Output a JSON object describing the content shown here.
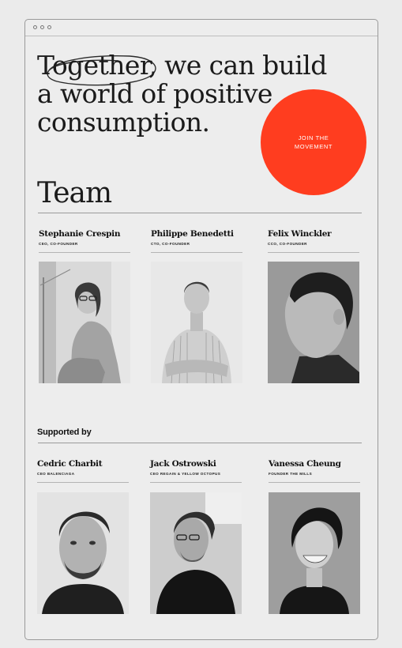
{
  "hero": {
    "line1_a": "Together,",
    "line1_b": " we can build",
    "line2": "a world of positive",
    "line3": "consumption."
  },
  "cta": {
    "line1": "JOIN THE",
    "line2": "MOVEMENT",
    "color": "#ff3d1f"
  },
  "team": {
    "title": "Team",
    "members": [
      {
        "name": "Stephanie Crespin",
        "role": "CEO, CO-FOUNDER",
        "photo": "portrait-woman-seated"
      },
      {
        "name": "Philippe Benedetti",
        "role": "CTO, CO-FOUNDER",
        "photo": "portrait-man-striped-shirt"
      },
      {
        "name": "Felix Winckler",
        "role": "CCO, CO-FOUNDER",
        "photo": "portrait-man-profile"
      }
    ]
  },
  "supported": {
    "title": "Supported by",
    "members": [
      {
        "name": "Cedric Charbit",
        "role": "CEO BALENCIAGA",
        "photo": "portrait-man-beard"
      },
      {
        "name": "Jack Ostrowski",
        "role": "CEO REGAIN & YELLOW OCTOPUS",
        "photo": "portrait-man-glasses"
      },
      {
        "name": "Vanessa Cheung",
        "role": "FOUNDER THE MILLS",
        "photo": "portrait-woman-smiling"
      }
    ]
  }
}
